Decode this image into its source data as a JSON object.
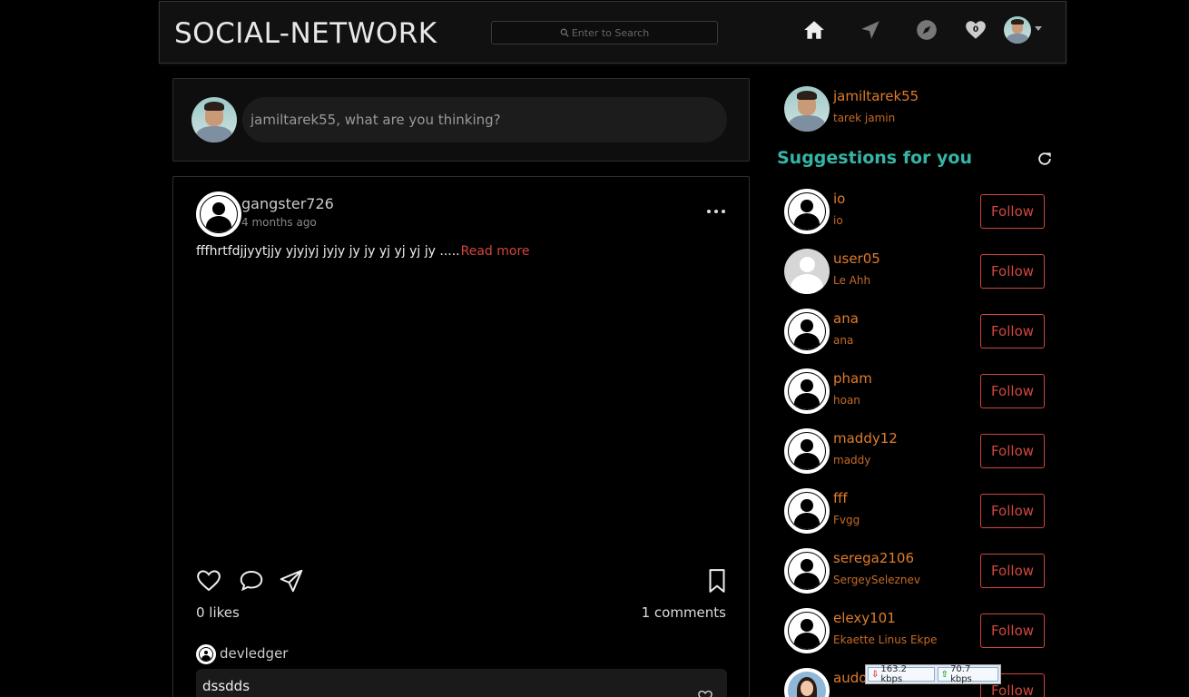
{
  "navbar": {
    "brand": "SOCIAL-NETWORK",
    "search_placeholder": "Enter to Search",
    "notification_count": "0"
  },
  "composer": {
    "placeholder": "jamiltarek55, what are you thinking?"
  },
  "post": {
    "username": "gangster726",
    "time": "4 months ago",
    "text": "fffhrtfdjjyytjjy yjyjyj jyjy jy jy yj yj yj jy .....",
    "read_more": "Read more",
    "likes": "0 likes",
    "comments": "1 comments",
    "comment": {
      "username": "devledger",
      "text": "dssdds"
    }
  },
  "sidebar": {
    "me": {
      "username": "jamiltarek55",
      "fullname": "tarek jamin"
    },
    "suggestions_title": "Suggestions for you",
    "follow_label": "Follow",
    "suggestions": [
      {
        "username": "io",
        "fullname": "io"
      },
      {
        "username": "user05",
        "fullname": "Le Ahh"
      },
      {
        "username": "ana",
        "fullname": "ana"
      },
      {
        "username": "pham",
        "fullname": "hoan"
      },
      {
        "username": "maddy12",
        "fullname": "maddy"
      },
      {
        "username": "fff",
        "fullname": "Fvgg"
      },
      {
        "username": "serega2106",
        "fullname": "SergeySeleznev"
      },
      {
        "username": "elexy101",
        "fullname": "Ekaette Linus Ekpe"
      },
      {
        "username": "audo",
        "fullname": ""
      }
    ]
  },
  "network_monitor": {
    "download": "163.2 kbps",
    "upload": "70.7 kbps"
  },
  "colors": {
    "accent_orange": "#e07c2a",
    "accent_red": "#d0473f",
    "accent_teal": "#35b5a6",
    "background": "#000000"
  },
  "icons": [
    "search-icon",
    "home-icon",
    "send-icon",
    "compass-icon",
    "heart-icon",
    "caret-down-icon",
    "more-icon",
    "like-icon",
    "comment-icon",
    "share-icon",
    "bookmark-icon",
    "refresh-icon"
  ]
}
